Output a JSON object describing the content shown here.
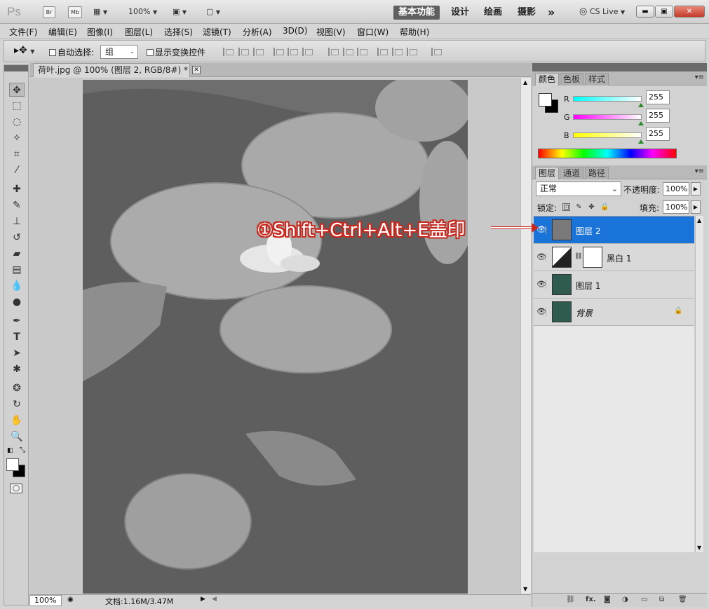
{
  "app": {
    "logo": "Ps",
    "bridge": "Br",
    "mini_bridge": "Mb",
    "zoom": "100%",
    "workspaces": [
      "基本功能",
      "设计",
      "绘画",
      "摄影"
    ],
    "more_workspaces": "»",
    "cs_live": "CS Live"
  },
  "menu": [
    "文件(F)",
    "编辑(E)",
    "图像(I)",
    "图层(L)",
    "选择(S)",
    "滤镜(T)",
    "分析(A)",
    "3D(D)",
    "视图(V)",
    "窗口(W)",
    "帮助(H)"
  ],
  "options": {
    "auto_select": "自动选择:",
    "auto_select_value": "组",
    "show_transform": "显示变换控件"
  },
  "document": {
    "tab_title": "荷叶.jpg @ 100% (图层 2, RGB/8#) *",
    "status_zoom": "100%",
    "doc_size": "文档:1.16M/3.47M"
  },
  "color_panel": {
    "tabs": [
      "颜色",
      "色板",
      "样式"
    ],
    "channels": [
      {
        "label": "R",
        "value": "255"
      },
      {
        "label": "G",
        "value": "255"
      },
      {
        "label": "B",
        "value": "255"
      }
    ]
  },
  "layers_panel": {
    "tabs": [
      "图层",
      "通道",
      "路径"
    ],
    "blend_mode": "正常",
    "opacity_label": "不透明度:",
    "opacity": "100%",
    "lock_label": "锁定:",
    "fill_label": "填充:",
    "fill": "100%",
    "layers": [
      {
        "name": "图层 2",
        "selected": true
      },
      {
        "name": "黑白 1",
        "selected": false
      },
      {
        "name": "图层 1",
        "selected": false
      },
      {
        "name": "背景",
        "selected": false
      }
    ]
  },
  "annotation": "①Shift+Ctrl+Alt+E盖印"
}
